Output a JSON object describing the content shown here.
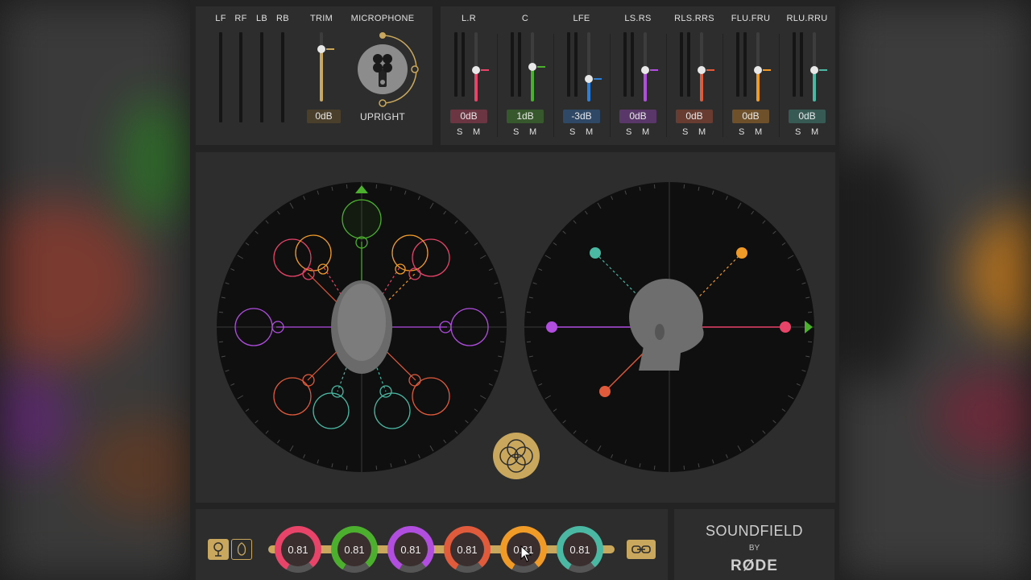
{
  "input_section": {
    "meter_labels": [
      "LF",
      "RF",
      "LB",
      "RB"
    ],
    "trim_label": "TRIM",
    "trim_value": "0dB",
    "microphone_label": "MICROPHONE",
    "orientation": "UPRIGHT"
  },
  "output_section": {
    "solo_label": "S",
    "mute_label": "M",
    "channels": [
      {
        "label": "L.R",
        "value": "0dB",
        "color": "#e8446a",
        "level": 0.45
      },
      {
        "label": "C",
        "value": "1dB",
        "color": "#4caf2e",
        "level": 0.5
      },
      {
        "label": "LFE",
        "value": "-3dB",
        "color": "#2f7fd6",
        "level": 0.33
      },
      {
        "label": "LS.RS",
        "value": "0dB",
        "color": "#b14ee0",
        "level": 0.45
      },
      {
        "label": "RLS.RRS",
        "value": "0dB",
        "color": "#e05a3c",
        "level": 0.45
      },
      {
        "label": "FLU.FRU",
        "value": "0dB",
        "color": "#f09a28",
        "level": 0.45
      },
      {
        "label": "RLU.RRU",
        "value": "0dB",
        "color": "#4ab8a2",
        "level": 0.45
      }
    ]
  },
  "gains": [
    {
      "value": "0.81",
      "color": "#e8446a"
    },
    {
      "value": "0.81",
      "color": "#4caf2e"
    },
    {
      "value": "0.81",
      "color": "#b14ee0"
    },
    {
      "value": "0.81",
      "color": "#e05a3c"
    },
    {
      "value": "0.81",
      "color": "#f09a28"
    },
    {
      "value": "0.81",
      "color": "#4ab8a2"
    }
  ],
  "brand": {
    "name": "SOUNDFIELD",
    "by": "BY",
    "maker": "RØDE"
  },
  "colors": {
    "accent": "#c9a85e",
    "panel": "#2d2d2d",
    "scope": "#0f0f0f"
  }
}
